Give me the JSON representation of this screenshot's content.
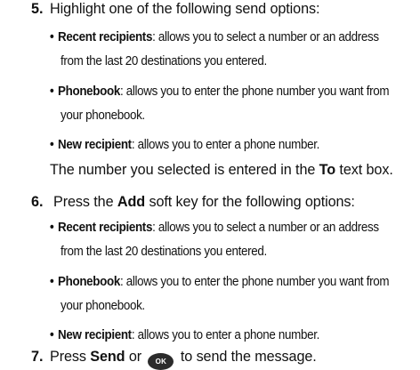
{
  "step5": {
    "number": "5.",
    "text": "Highlight one of the following send options:",
    "bullets": [
      {
        "term": "Recent recipients",
        "desc": ": allows you to select a number or an address",
        "cont": "from the last 20 destinations you entered."
      },
      {
        "term": "Phonebook",
        "desc": ": allows you to enter the phone number you want from",
        "cont": "your phonebook."
      },
      {
        "term": "New recipient",
        "desc": ": allows you to enter a phone number."
      }
    ],
    "note_before": "The number you selected is entered in the ",
    "note_field": "To",
    "note_after": " text box."
  },
  "step6": {
    "number": "6.",
    "text_before": "Press the ",
    "key": "Add",
    "text_after": " soft key for the following options:",
    "bullets": [
      {
        "term": "Recent recipients",
        "desc": ": allows you to select a number or an address",
        "cont": "from the last 20 destinations you entered."
      },
      {
        "term": "Phonebook",
        "desc": ": allows you to enter the phone number you want from",
        "cont": "your phonebook."
      },
      {
        "term": "New recipient",
        "desc": ": allows you to enter a phone number."
      }
    ]
  },
  "step7": {
    "number": "7.",
    "text_before": "Press ",
    "key": "Send",
    "text_or": " or ",
    "ok_icon": "ok-key-icon",
    "ok_label": "OK",
    "text_after": " to send the message."
  }
}
